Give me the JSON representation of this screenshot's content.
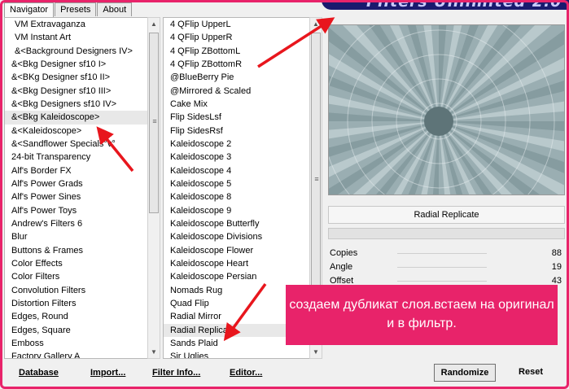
{
  "tabs": [
    "Navigator",
    "Presets",
    "About"
  ],
  "app_title": "Filters Unlimited 2.0",
  "categories": [
    "VM Extravaganza",
    "VM Instant Art",
    "&<Background Designers IV>",
    "&<Bkg Designer sf10 I>",
    "&<BKg Designer sf10 II>",
    "&<Bkg Designer sf10 III>",
    "&<Bkg Designers sf10 IV>",
    "&<Bkg Kaleidoscope>",
    "&<Kaleidoscope>",
    "&<Sandflower Specials°v°",
    "24-bit Transparency",
    "Alf's Border FX",
    "Alf's Power Grads",
    "Alf's Power Sines",
    "Alf's Power Toys",
    "Andrew's Filters 6",
    "Blur",
    "Buttons & Frames",
    "Color Effects",
    "Color Filters",
    "Convolution Filters",
    "Distortion Filters",
    "Edges, Round",
    "Edges, Square",
    "Emboss",
    "Factory Gallery A"
  ],
  "selected_category_index": 7,
  "filters": [
    "4 QFlip UpperL",
    "4 QFlip UpperR",
    "4 QFlip ZBottomL",
    "4 QFlip ZBottomR",
    "@BlueBerry Pie",
    "@Mirrored & Scaled",
    "Cake Mix",
    "Flip SidesLsf",
    "Flip SidesRsf",
    "Kaleidoscope 2",
    "Kaleidoscope 3",
    "Kaleidoscope 4",
    "Kaleidoscope 5",
    "Kaleidoscope 8",
    "Kaleidoscope 9",
    "Kaleidoscope Butterfly",
    "Kaleidoscope Divisions",
    "Kaleidoscope Flower",
    "Kaleidoscope Heart",
    "Kaleidoscope Persian",
    "Nomads Rug",
    "Quad Flip",
    "Radial Mirror",
    "Radial Replicate",
    "Sands Plaid",
    "Sir Uglies"
  ],
  "selected_filter_index": 23,
  "preview_caption": "Radial Replicate",
  "params": [
    {
      "name": "Copies",
      "value": "88"
    },
    {
      "name": "Angle",
      "value": "19"
    },
    {
      "name": "Offset",
      "value": "43"
    }
  ],
  "bottom_buttons": [
    "Database",
    "Import...",
    "Filter Info...",
    "Editor..."
  ],
  "randomize_label": "Randomize",
  "reset_label": "Reset",
  "callout_text": "создаем дубликат слоя.встаем на оригинал и в фильтр.",
  "colors": {
    "accent": "#e8236a",
    "arrow": "#e8161d",
    "preview_bg": "#9aaeb2"
  },
  "icons": {
    "scroll_up": "triangle-up",
    "scroll_down": "triangle-down",
    "grip": "grip-lines"
  }
}
